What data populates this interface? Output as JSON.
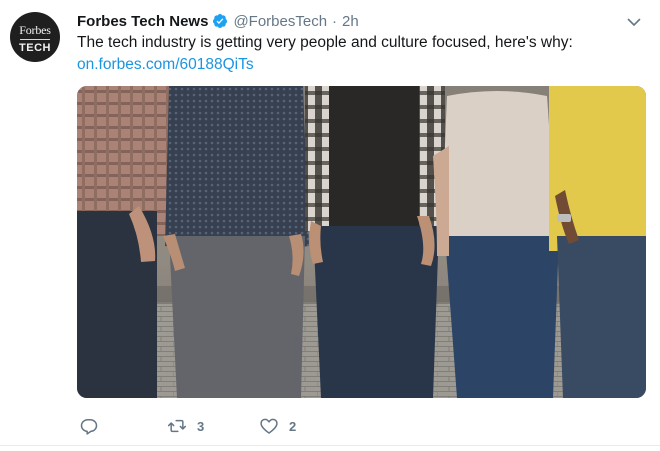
{
  "tweet": {
    "author": {
      "name": "Forbes Tech News",
      "handle": "@ForbesTech",
      "verified": true,
      "avatar": {
        "brand": "Forbes",
        "sub": "TECH",
        "icon": "forbes-tech-logo"
      }
    },
    "time_separator": "·",
    "time": "2h",
    "text": "The tech industry is getting very people and culture focused, here's why:",
    "link": "on.forbes.com/60188QiTs",
    "media": {
      "alt_icon": "photo-of-people-standing-against-wall"
    },
    "actions": {
      "reply": {
        "icon": "reply-icon"
      },
      "retweet": {
        "icon": "retweet-icon",
        "count": "3"
      },
      "like": {
        "icon": "heart-icon",
        "count": "2"
      }
    },
    "menu_icon": "chevron-down-icon"
  },
  "colors": {
    "text": "#14171a",
    "muted": "#657786",
    "link": "#1b95e0",
    "verified": "#1da1f2",
    "border": "#e6ecf0"
  }
}
